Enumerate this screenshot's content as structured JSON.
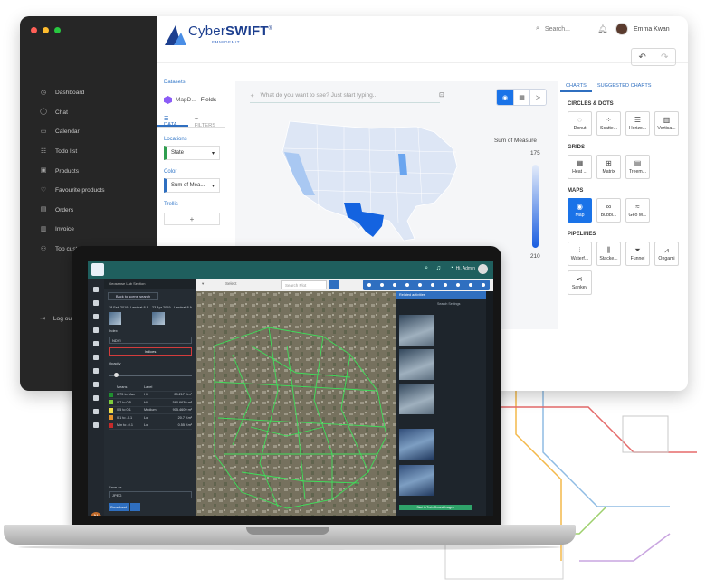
{
  "window": {
    "dot_colors": [
      "#ff5f57",
      "#febc2e",
      "#28c840"
    ],
    "nav": [
      {
        "label": "Dashboard",
        "icon": "clock-icon"
      },
      {
        "label": "Chat",
        "icon": "chat-icon"
      },
      {
        "label": "Calendar",
        "icon": "calendar-icon"
      },
      {
        "label": "Todo list",
        "icon": "checklist-icon"
      },
      {
        "label": "Products",
        "icon": "box-icon"
      },
      {
        "label": "Favourite products",
        "icon": "heart-icon"
      },
      {
        "label": "Orders",
        "icon": "orders-icon"
      },
      {
        "label": "Invoice",
        "icon": "invoice-icon"
      },
      {
        "label": "Top customers",
        "icon": "user-icon"
      }
    ],
    "logout_label": "Log out"
  },
  "header": {
    "brand_prefix": "Cyber",
    "brand_bold": "SWIFT",
    "brand_tm": "®",
    "brand_sub": "EMMIDEMIT",
    "search_placeholder": "Search...",
    "user_name": "Emma Kwan",
    "accent": "#1a73e8"
  },
  "fields_panel": {
    "datasets_label": "Datasets",
    "dataset_name": "MapD...",
    "fields_label": "Fields",
    "tab_data": "DATA",
    "tab_filters": "FILTERS",
    "locations_label": "Locations",
    "locations_value": "State",
    "color_label": "Color",
    "color_value": "Sum of Mea...",
    "trellis_label": "Trellis",
    "add_label": "+"
  },
  "canvas": {
    "ask_placeholder": "What do you want to see? Just start typing...",
    "legend_title": "Sum of Measure",
    "legend_max": "175",
    "legend_min": "210"
  },
  "right_panel": {
    "tab_charts": "CHARTS",
    "tab_suggested": "SUGGESTED CHARTS",
    "sections": [
      {
        "title": "CIRCLES & DOTS",
        "items": [
          {
            "label": "Donut",
            "icon": "donut-icon",
            "glyph": "◌"
          },
          {
            "label": "Scatte...",
            "icon": "scatter-icon",
            "glyph": "⁘"
          },
          {
            "label": "Horizo...",
            "icon": "horizontal-bar-icon",
            "glyph": "☰"
          },
          {
            "label": "Vertica...",
            "icon": "vertical-bar-icon",
            "glyph": "▥"
          }
        ]
      },
      {
        "title": "GRIDS",
        "items": [
          {
            "label": "Heat ...",
            "icon": "heatmap-icon",
            "glyph": "▦"
          },
          {
            "label": "Matrix",
            "icon": "matrix-icon",
            "glyph": "⊞"
          },
          {
            "label": "Treem...",
            "icon": "treemap-icon",
            "glyph": "▤"
          }
        ]
      },
      {
        "title": "MAPS",
        "items": [
          {
            "label": "Map",
            "icon": "map-pin-icon",
            "glyph": "◉",
            "selected": true
          },
          {
            "label": "Bubbl...",
            "icon": "bubble-map-icon",
            "glyph": "∞"
          },
          {
            "label": "Geo M...",
            "icon": "geo-map-icon",
            "glyph": "≈"
          }
        ]
      },
      {
        "title": "PIPELINES",
        "items": [
          {
            "label": "Waterf...",
            "icon": "waterfall-icon",
            "glyph": "⫶"
          },
          {
            "label": "Stacke...",
            "icon": "stacked-icon",
            "glyph": "⫼"
          },
          {
            "label": "Funnel",
            "icon": "funnel-icon",
            "glyph": "⏷"
          },
          {
            "label": "Ongami",
            "icon": "ongami-icon",
            "glyph": "⩘"
          }
        ]
      },
      {
        "title": "",
        "items": [
          {
            "label": "Sankey",
            "icon": "sankey-icon",
            "glyph": "⋖"
          }
        ]
      }
    ]
  },
  "laptop": {
    "admin_label": "Hi, Admin",
    "panel_header": "Geosense Lab Section",
    "back_label": "Back to scene search",
    "date_left": "18 Feb 2019",
    "date_right": "23 Apr 2019",
    "landsat_left": "Landsat 8 A",
    "landsat_right": "Landsat 8 A",
    "index_label": "Index",
    "index_value": "NDVI",
    "red_button": "Indices",
    "opacity_label": "Opacity",
    "legend_headers": [
      "Means",
      "Label",
      ""
    ],
    "legend_rows": [
      {
        "color": "#1f8f2f",
        "range": "0.75 to Max",
        "label": "Hi",
        "area": "28.217 Km²"
      },
      {
        "color": "#7ccc3c",
        "range": "0.7 to 0.5",
        "label": "Hi",
        "area": "560.6639 m²"
      },
      {
        "color": "#f3e04a",
        "range": "0.5 to 0.1",
        "label": "Medium",
        "area": "905.4609 m²"
      },
      {
        "color": "#e8932c",
        "range": "0.1 to -0.1",
        "label": "Lo",
        "area": "20.7 Km²"
      },
      {
        "color": "#c62a2a",
        "range": "Min to -0.1",
        "label": "Lo",
        "area": "0.55 Km²"
      }
    ],
    "export_label": "Save as",
    "export_value": "JPEG",
    "download_label": "Download",
    "select_placeholder": "Select",
    "search_plot": "Search Plot",
    "side_header": "Related activities",
    "side_title": "Search Settings",
    "green_button": "Start to Train Ground Images"
  }
}
